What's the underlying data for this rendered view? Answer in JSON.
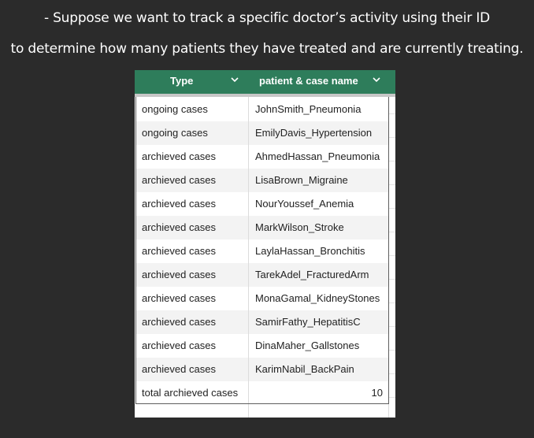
{
  "caption": {
    "line1": "- Suppose we want to track a specific doctor’s activity using their ID",
    "line2": "to determine how many patients they have treated and are currently treating."
  },
  "table": {
    "headers": [
      {
        "label": "Type",
        "icon": "chevron-down-icon"
      },
      {
        "label": "patient & case name",
        "icon": "chevron-down-icon"
      }
    ],
    "header_color": "#2e7d5b",
    "rows": [
      {
        "type": "ongoing cases",
        "name": "JohnSmith_Pneumonia"
      },
      {
        "type": "ongoing cases",
        "name": "EmilyDavis_Hypertension"
      },
      {
        "type": "archieved cases",
        "name": "AhmedHassan_Pneumonia"
      },
      {
        "type": "archieved cases",
        "name": "LisaBrown_Migraine"
      },
      {
        "type": "archieved cases",
        "name": "NourYoussef_Anemia"
      },
      {
        "type": "archieved cases",
        "name": "MarkWilson_Stroke"
      },
      {
        "type": "archieved cases",
        "name": "LaylaHassan_Bronchitis"
      },
      {
        "type": "archieved cases",
        "name": "TarekAdel_FracturedArm"
      },
      {
        "type": "archieved cases",
        "name": "MonaGamal_KidneyStones"
      },
      {
        "type": "archieved cases",
        "name": "SamirFathy_HepatitisC"
      },
      {
        "type": "archieved cases",
        "name": "DinaMaher_Gallstones"
      },
      {
        "type": "archieved cases",
        "name": "KarimNabil_BackPain"
      }
    ],
    "total": {
      "label": "total archieved cases",
      "value": "10"
    }
  }
}
